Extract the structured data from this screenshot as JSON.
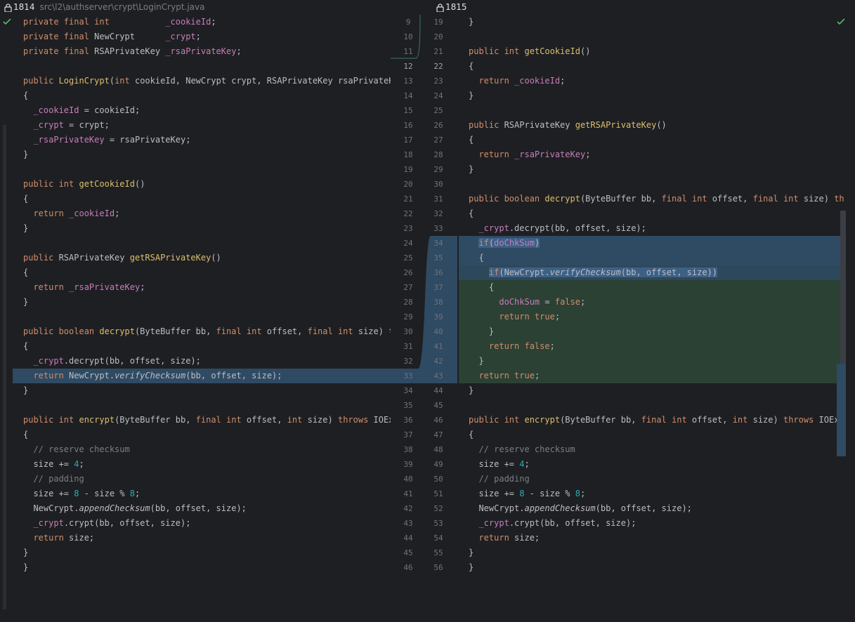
{
  "left_header": {
    "rev": "1814",
    "path": "src\\l2\\authserver\\crypt\\LoginCrypt.java"
  },
  "right_header": {
    "rev": "1815"
  },
  "gutter_lines": [
    [
      "9",
      "19"
    ],
    [
      "10",
      "20"
    ],
    [
      "11",
      "21"
    ],
    [
      "12",
      "22"
    ],
    [
      "13",
      "23"
    ],
    [
      "14",
      "24"
    ],
    [
      "15",
      "25"
    ],
    [
      "16",
      "26"
    ],
    [
      "17",
      "27"
    ],
    [
      "18",
      "28"
    ],
    [
      "19",
      "29"
    ],
    [
      "20",
      "30"
    ],
    [
      "21",
      "31"
    ],
    [
      "22",
      "32"
    ],
    [
      "23",
      "33"
    ],
    [
      "24",
      "34"
    ],
    [
      "25",
      "35"
    ],
    [
      "26",
      "36"
    ],
    [
      "27",
      "37"
    ],
    [
      "28",
      "38"
    ],
    [
      "29",
      "39"
    ],
    [
      "30",
      "40"
    ],
    [
      "31",
      "41"
    ],
    [
      "32",
      "42"
    ],
    [
      "33",
      "43"
    ],
    [
      "34",
      "44"
    ],
    [
      "35",
      "45"
    ],
    [
      "36",
      "46"
    ],
    [
      "37",
      "47"
    ],
    [
      "38",
      "48"
    ],
    [
      "39",
      "49"
    ],
    [
      "40",
      "50"
    ],
    [
      "41",
      "51"
    ],
    [
      "42",
      "52"
    ],
    [
      "43",
      "53"
    ],
    [
      "44",
      "54"
    ],
    [
      "45",
      "55"
    ],
    [
      "46",
      "56"
    ]
  ],
  "left_code": [
    [
      [
        "kw",
        "private final int           "
      ],
      [
        "fld",
        "_cookieId"
      ],
      [
        "tx",
        ";"
      ]
    ],
    [
      [
        "kw",
        "private final "
      ],
      [
        "tx",
        "NewCrypt      "
      ],
      [
        "fld",
        "_crypt"
      ],
      [
        "tx",
        ";"
      ]
    ],
    [
      [
        "kw",
        "private final "
      ],
      [
        "tx",
        "RSAPrivateKey "
      ],
      [
        "fld",
        "_rsaPrivateKey"
      ],
      [
        "tx",
        ";"
      ]
    ],
    [],
    [
      [
        "kw",
        "public "
      ],
      [
        "fnd",
        "LoginCrypt"
      ],
      [
        "tx",
        "("
      ],
      [
        "kw",
        "int "
      ],
      [
        "tx",
        "cookieId, NewCrypt crypt, RSAPrivateKey rsaPrivateKey"
      ]
    ],
    [
      [
        "tx",
        "{"
      ]
    ],
    [
      [
        "tx",
        "  "
      ],
      [
        "fld",
        "_cookieId"
      ],
      [
        "tx",
        " = cookieId;"
      ]
    ],
    [
      [
        "tx",
        "  "
      ],
      [
        "fld",
        "_crypt"
      ],
      [
        "tx",
        " = crypt;"
      ]
    ],
    [
      [
        "tx",
        "  "
      ],
      [
        "fld",
        "_rsaPrivateKey"
      ],
      [
        "tx",
        " = rsaPrivateKey;"
      ]
    ],
    [
      [
        "tx",
        "}"
      ]
    ],
    [],
    [
      [
        "kw",
        "public int "
      ],
      [
        "fnd",
        "getCookieId"
      ],
      [
        "tx",
        "()"
      ]
    ],
    [
      [
        "tx",
        "{"
      ]
    ],
    [
      [
        "tx",
        "  "
      ],
      [
        "kw",
        "return "
      ],
      [
        "fld",
        "_cookieId"
      ],
      [
        "tx",
        ";"
      ]
    ],
    [
      [
        "tx",
        "}"
      ]
    ],
    [],
    [
      [
        "kw",
        "public "
      ],
      [
        "tx",
        "RSAPrivateKey "
      ],
      [
        "fnd",
        "getRSAPrivateKey"
      ],
      [
        "tx",
        "()"
      ]
    ],
    [
      [
        "tx",
        "{"
      ]
    ],
    [
      [
        "tx",
        "  "
      ],
      [
        "kw",
        "return "
      ],
      [
        "fld",
        "_rsaPrivateKey"
      ],
      [
        "tx",
        ";"
      ]
    ],
    [
      [
        "tx",
        "}"
      ]
    ],
    [],
    [
      [
        "kw",
        "public boolean "
      ],
      [
        "fnd",
        "decrypt"
      ],
      [
        "tx",
        "(ByteBuffer bb, "
      ],
      [
        "kw",
        "final int "
      ],
      [
        "tx",
        "offset, "
      ],
      [
        "kw",
        "final int "
      ],
      [
        "tx",
        "size) "
      ],
      [
        "kw",
        "throws"
      ]
    ],
    [
      [
        "tx",
        "{"
      ]
    ],
    [
      [
        "tx",
        "  "
      ],
      [
        "fld",
        "_crypt"
      ],
      [
        "tx",
        ".decrypt(bb, offset, size);"
      ]
    ],
    [
      [
        "tx",
        "  "
      ],
      [
        "kw",
        "return "
      ],
      [
        "tx",
        "NewCrypt."
      ],
      [
        "it",
        "verifyChecksum"
      ],
      [
        "tx",
        "(bb, offset, size);"
      ]
    ],
    [
      [
        "tx",
        "}"
      ]
    ],
    [],
    [
      [
        "kw",
        "public int "
      ],
      [
        "fnd",
        "encrypt"
      ],
      [
        "tx",
        "(ByteBuffer bb, "
      ],
      [
        "kw",
        "final int "
      ],
      [
        "tx",
        "offset, "
      ],
      [
        "kw",
        "int "
      ],
      [
        "tx",
        "size) "
      ],
      [
        "kw",
        "throws "
      ],
      [
        "tx",
        "IOException"
      ]
    ],
    [
      [
        "tx",
        "{"
      ]
    ],
    [
      [
        "tx",
        "  "
      ],
      [
        "cm",
        "// reserve checksum"
      ]
    ],
    [
      [
        "tx",
        "  size += "
      ],
      [
        "num",
        "4"
      ],
      [
        "tx",
        ";"
      ]
    ],
    [
      [
        "tx",
        "  "
      ],
      [
        "cm",
        "// padding"
      ]
    ],
    [
      [
        "tx",
        "  size += "
      ],
      [
        "num",
        "8"
      ],
      [
        "tx",
        " - size % "
      ],
      [
        "num",
        "8"
      ],
      [
        "tx",
        ";"
      ]
    ],
    [
      [
        "tx",
        "  NewCrypt."
      ],
      [
        "it",
        "appendChecksum"
      ],
      [
        "tx",
        "(bb, offset, size);"
      ]
    ],
    [
      [
        "tx",
        "  "
      ],
      [
        "fld",
        "_crypt"
      ],
      [
        "tx",
        ".crypt(bb, offset, size);"
      ]
    ],
    [
      [
        "tx",
        "  "
      ],
      [
        "kw",
        "return "
      ],
      [
        "tx",
        "size;"
      ]
    ],
    [
      [
        "tx",
        "}"
      ]
    ],
    [
      [
        "tx",
        "}"
      ]
    ]
  ],
  "right_code": [
    [
      [
        "tx",
        "}"
      ]
    ],
    [],
    [
      [
        "kw",
        "public int "
      ],
      [
        "fnd",
        "getCookieId"
      ],
      [
        "tx",
        "()"
      ]
    ],
    [
      [
        "tx",
        "{"
      ]
    ],
    [
      [
        "tx",
        "  "
      ],
      [
        "kw",
        "return "
      ],
      [
        "fld",
        "_cookieId"
      ],
      [
        "tx",
        ";"
      ]
    ],
    [
      [
        "tx",
        "}"
      ]
    ],
    [],
    [
      [
        "kw",
        "public "
      ],
      [
        "tx",
        "RSAPrivateKey "
      ],
      [
        "fnd",
        "getRSAPrivateKey"
      ],
      [
        "tx",
        "()"
      ]
    ],
    [
      [
        "tx",
        "{"
      ]
    ],
    [
      [
        "tx",
        "  "
      ],
      [
        "kw",
        "return "
      ],
      [
        "fld",
        "_rsaPrivateKey"
      ],
      [
        "tx",
        ";"
      ]
    ],
    [
      [
        "tx",
        "}"
      ]
    ],
    [],
    [
      [
        "kw",
        "public boolean "
      ],
      [
        "fnd",
        "decrypt"
      ],
      [
        "tx",
        "(ByteBuffer bb, "
      ],
      [
        "kw",
        "final int "
      ],
      [
        "tx",
        "offset, "
      ],
      [
        "kw",
        "final int "
      ],
      [
        "tx",
        "size) "
      ],
      [
        "kw",
        "throws"
      ]
    ],
    [
      [
        "tx",
        "{"
      ]
    ],
    [
      [
        "tx",
        "  "
      ],
      [
        "fld",
        "_crypt"
      ],
      [
        "tx",
        ".decrypt(bb, offset, size);"
      ]
    ],
    [
      [
        "tx",
        "  "
      ],
      [
        "kw",
        "if"
      ],
      [
        "tx",
        "("
      ],
      [
        "fld",
        "doChkSum"
      ],
      [
        "tx",
        ")"
      ]
    ],
    [
      [
        "tx",
        "  {"
      ]
    ],
    [
      [
        "tx",
        "    "
      ],
      [
        "kw",
        "if"
      ],
      [
        "tx",
        "(NewCrypt."
      ],
      [
        "it",
        "verifyChecksum"
      ],
      [
        "tx",
        "(bb, offset, size))"
      ]
    ],
    [
      [
        "tx",
        "    {"
      ]
    ],
    [
      [
        "tx",
        "      "
      ],
      [
        "fld",
        "doChkSum"
      ],
      [
        "tx",
        " = "
      ],
      [
        "kw",
        "false"
      ],
      [
        "tx",
        ";"
      ]
    ],
    [
      [
        "tx",
        "      "
      ],
      [
        "kw",
        "return true"
      ],
      [
        "tx",
        ";"
      ]
    ],
    [
      [
        "tx",
        "    }"
      ]
    ],
    [
      [
        "tx",
        "    "
      ],
      [
        "kw",
        "return false"
      ],
      [
        "tx",
        ";"
      ]
    ],
    [
      [
        "tx",
        "  }"
      ]
    ],
    [
      [
        "tx",
        "  "
      ],
      [
        "kw",
        "return true"
      ],
      [
        "tx",
        ";"
      ]
    ],
    [
      [
        "tx",
        "}"
      ]
    ],
    [],
    [
      [
        "kw",
        "public int "
      ],
      [
        "fnd",
        "encrypt"
      ],
      [
        "tx",
        "(ByteBuffer bb, "
      ],
      [
        "kw",
        "final int "
      ],
      [
        "tx",
        "offset, "
      ],
      [
        "kw",
        "int "
      ],
      [
        "tx",
        "size) "
      ],
      [
        "kw",
        "throws "
      ],
      [
        "tx",
        "IOException"
      ]
    ],
    [
      [
        "tx",
        "{"
      ]
    ],
    [
      [
        "tx",
        "  "
      ],
      [
        "cm",
        "// reserve checksum"
      ]
    ],
    [
      [
        "tx",
        "  size += "
      ],
      [
        "num",
        "4"
      ],
      [
        "tx",
        ";"
      ]
    ],
    [
      [
        "tx",
        "  "
      ],
      [
        "cm",
        "// padding"
      ]
    ],
    [
      [
        "tx",
        "  size += "
      ],
      [
        "num",
        "8"
      ],
      [
        "tx",
        " - size % "
      ],
      [
        "num",
        "8"
      ],
      [
        "tx",
        ";"
      ]
    ],
    [
      [
        "tx",
        "  NewCrypt."
      ],
      [
        "it",
        "appendChecksum"
      ],
      [
        "tx",
        "(bb, offset, size);"
      ]
    ],
    [
      [
        "tx",
        "  "
      ],
      [
        "fld",
        "_crypt"
      ],
      [
        "tx",
        ".crypt(bb, offset, size);"
      ]
    ],
    [
      [
        "tx",
        "  "
      ],
      [
        "kw",
        "return "
      ],
      [
        "tx",
        "size;"
      ]
    ],
    [
      [
        "tx",
        "}"
      ]
    ],
    [
      [
        "tx",
        "}"
      ]
    ]
  ],
  "colors": {
    "background": "#1e1f22",
    "modified": "#2f4a63",
    "added": "#2b4134",
    "keyword": "#cf8e6d",
    "field": "#c77dbb",
    "method": "#dcbf6f",
    "number": "#2aacb8",
    "comment": "#7a7e85"
  }
}
